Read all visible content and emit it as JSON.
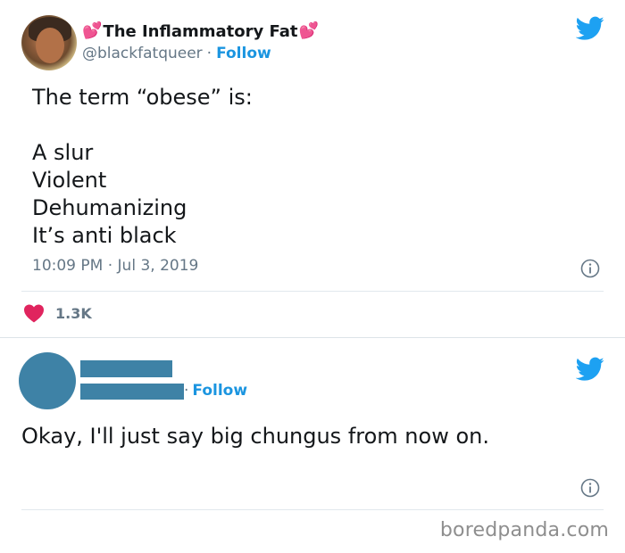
{
  "tweets": [
    {
      "author": {
        "display_name": "The Inflammatory Fat",
        "handle": "@blackfatqueer",
        "follow_label": "Follow",
        "name_prefix_emoji": "💕",
        "name_suffix_emoji": "💕"
      },
      "text_lines": [
        "The term “obese” is:",
        "",
        "A slur",
        "Violent",
        "Dehumanizing",
        "It’s anti black"
      ],
      "timestamp": "10:09 PM · Jul 3, 2019",
      "likes": "1.3K",
      "icons": [
        "twitter-bird-icon",
        "info-icon",
        "heart-icon"
      ]
    },
    {
      "author": {
        "display_name": "",
        "handle": "",
        "follow_label": "Follow",
        "redacted": true
      },
      "text": "Okay, I'll just say big chungus from now on.",
      "icons": [
        "twitter-bird-icon",
        "info-icon"
      ]
    }
  ],
  "watermark": "boredpanda.com",
  "colors": {
    "twitter_blue": "#1da1f2",
    "link_blue": "#1b95e0",
    "like_red": "#e0245e",
    "muted_text": "#657786",
    "redaction": "#3e82a6"
  }
}
